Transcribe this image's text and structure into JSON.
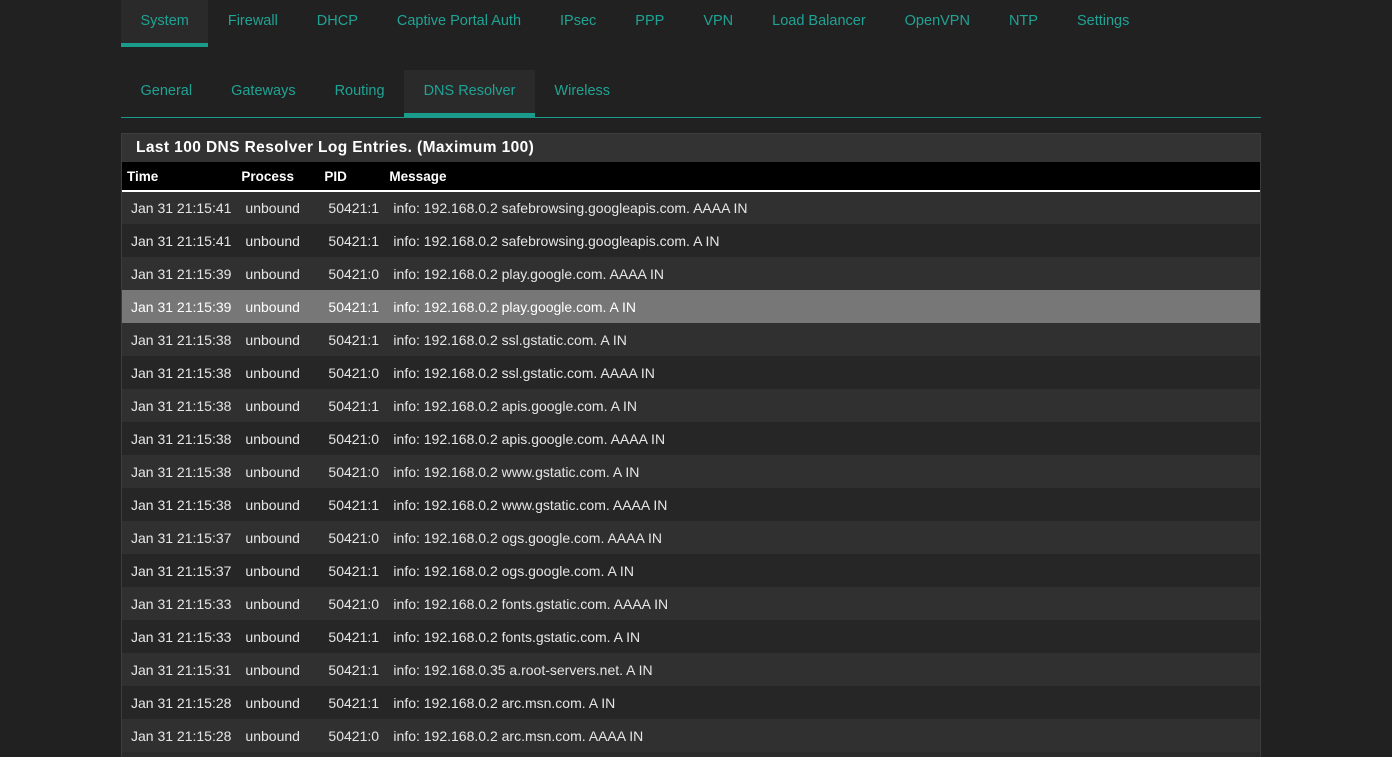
{
  "top_tabs": [
    {
      "label": "System",
      "active": true
    },
    {
      "label": "Firewall"
    },
    {
      "label": "DHCP"
    },
    {
      "label": "Captive Portal Auth"
    },
    {
      "label": "IPsec"
    },
    {
      "label": "PPP"
    },
    {
      "label": "VPN"
    },
    {
      "label": "Load Balancer"
    },
    {
      "label": "OpenVPN"
    },
    {
      "label": "NTP"
    },
    {
      "label": "Settings"
    }
  ],
  "sub_tabs": [
    {
      "label": "General"
    },
    {
      "label": "Gateways"
    },
    {
      "label": "Routing"
    },
    {
      "label": "DNS Resolver",
      "active": true
    },
    {
      "label": "Wireless"
    }
  ],
  "panel": {
    "title": "Last 100 DNS Resolver Log Entries. (Maximum 100)"
  },
  "table": {
    "headers": [
      "Time",
      "Process",
      "PID",
      "Message"
    ],
    "highlighted_row": 3,
    "rows": [
      {
        "time": "Jan 31 21:15:41",
        "process": "unbound",
        "pid": "50421:1",
        "message": "info: 192.168.0.2 safebrowsing.googleapis.com. AAAA IN"
      },
      {
        "time": "Jan 31 21:15:41",
        "process": "unbound",
        "pid": "50421:1",
        "message": "info: 192.168.0.2 safebrowsing.googleapis.com. A IN"
      },
      {
        "time": "Jan 31 21:15:39",
        "process": "unbound",
        "pid": "50421:0",
        "message": "info: 192.168.0.2 play.google.com. AAAA IN"
      },
      {
        "time": "Jan 31 21:15:39",
        "process": "unbound",
        "pid": "50421:1",
        "message": "info: 192.168.0.2 play.google.com. A IN"
      },
      {
        "time": "Jan 31 21:15:38",
        "process": "unbound",
        "pid": "50421:1",
        "message": "info: 192.168.0.2 ssl.gstatic.com. A IN"
      },
      {
        "time": "Jan 31 21:15:38",
        "process": "unbound",
        "pid": "50421:0",
        "message": "info: 192.168.0.2 ssl.gstatic.com. AAAA IN"
      },
      {
        "time": "Jan 31 21:15:38",
        "process": "unbound",
        "pid": "50421:1",
        "message": "info: 192.168.0.2 apis.google.com. A IN"
      },
      {
        "time": "Jan 31 21:15:38",
        "process": "unbound",
        "pid": "50421:0",
        "message": "info: 192.168.0.2 apis.google.com. AAAA IN"
      },
      {
        "time": "Jan 31 21:15:38",
        "process": "unbound",
        "pid": "50421:0",
        "message": "info: 192.168.0.2 www.gstatic.com. A IN"
      },
      {
        "time": "Jan 31 21:15:38",
        "process": "unbound",
        "pid": "50421:1",
        "message": "info: 192.168.0.2 www.gstatic.com. AAAA IN"
      },
      {
        "time": "Jan 31 21:15:37",
        "process": "unbound",
        "pid": "50421:0",
        "message": "info: 192.168.0.2 ogs.google.com. AAAA IN"
      },
      {
        "time": "Jan 31 21:15:37",
        "process": "unbound",
        "pid": "50421:1",
        "message": "info: 192.168.0.2 ogs.google.com. A IN"
      },
      {
        "time": "Jan 31 21:15:33",
        "process": "unbound",
        "pid": "50421:0",
        "message": "info: 192.168.0.2 fonts.gstatic.com. AAAA IN"
      },
      {
        "time": "Jan 31 21:15:33",
        "process": "unbound",
        "pid": "50421:1",
        "message": "info: 192.168.0.2 fonts.gstatic.com. A IN"
      },
      {
        "time": "Jan 31 21:15:31",
        "process": "unbound",
        "pid": "50421:1",
        "message": "info: 192.168.0.35 a.root-servers.net. A IN"
      },
      {
        "time": "Jan 31 21:15:28",
        "process": "unbound",
        "pid": "50421:1",
        "message": "info: 192.168.0.2 arc.msn.com. A IN"
      },
      {
        "time": "Jan 31 21:15:28",
        "process": "unbound",
        "pid": "50421:0",
        "message": "info: 192.168.0.2 arc.msn.com. AAAA IN"
      }
    ]
  }
}
